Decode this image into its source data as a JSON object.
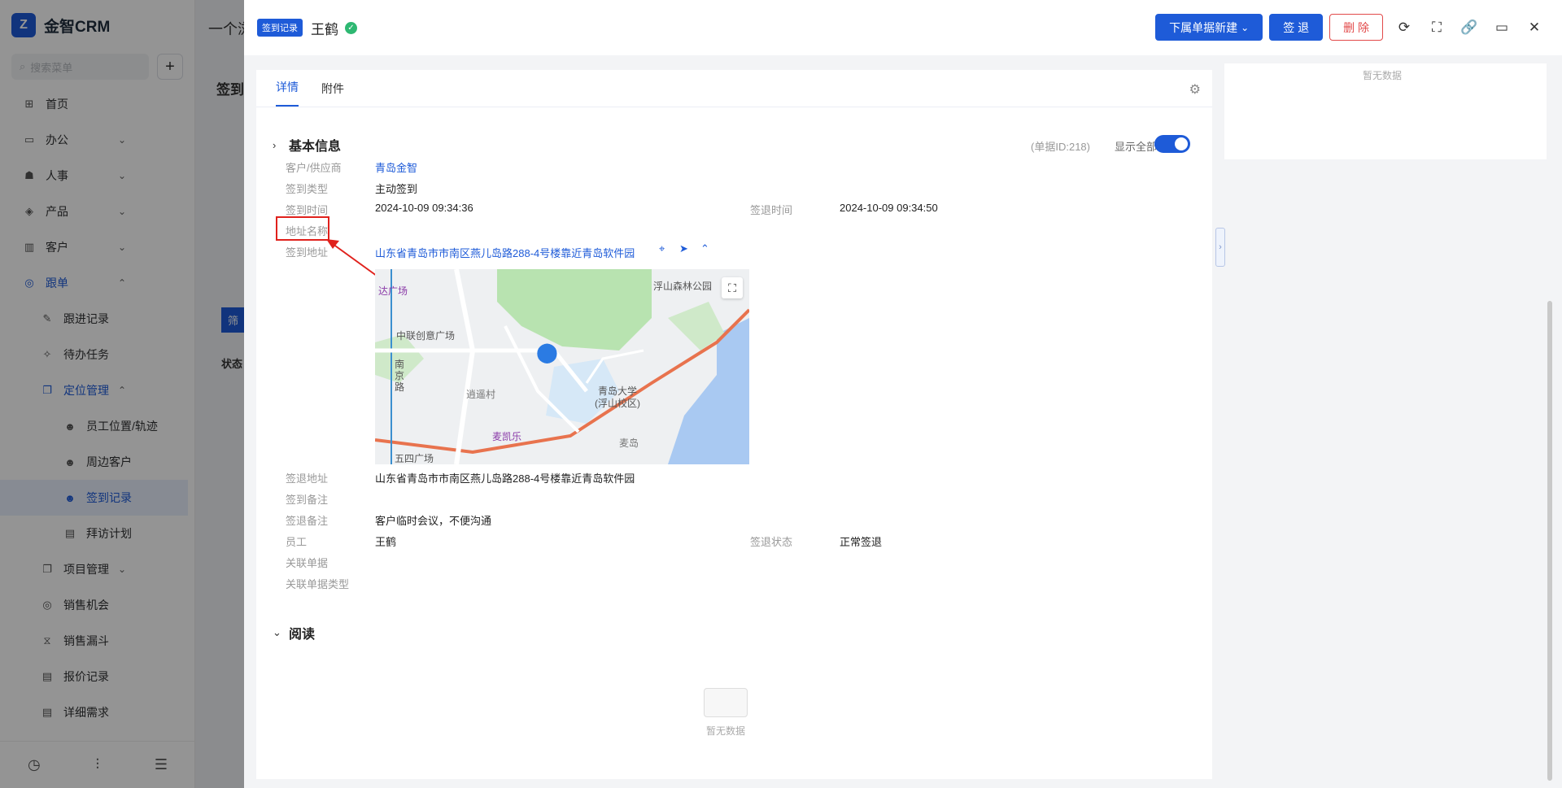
{
  "app": {
    "brand": "金智CRM",
    "breadcrumb": "一个浏",
    "search_placeholder": "搜索菜单",
    "add_icon": "plus-icon",
    "menu": [
      {
        "label": "首页",
        "icon": "home-icon",
        "level": 1
      },
      {
        "label": "办公",
        "icon": "office-icon",
        "level": 1,
        "chevron": "down"
      },
      {
        "label": "人事",
        "icon": "people-icon",
        "level": 1,
        "chevron": "down"
      },
      {
        "label": "产品",
        "icon": "product-icon",
        "level": 1,
        "chevron": "down"
      },
      {
        "label": "客户",
        "icon": "customer-icon",
        "level": 1,
        "chevron": "down"
      },
      {
        "label": "跟单",
        "icon": "track-icon",
        "level": 1,
        "chevron": "up",
        "active": true
      },
      {
        "label": "跟进记录",
        "icon": "note-icon",
        "level": 2
      },
      {
        "label": "待办任务",
        "icon": "pin-icon",
        "level": 2
      },
      {
        "label": "定位管理",
        "icon": "location-mgmt-icon",
        "level": 2,
        "chevron": "up",
        "active": true
      },
      {
        "label": "员工位置/轨迹",
        "icon": "staff-location-icon",
        "level": 3
      },
      {
        "label": "周边客户",
        "icon": "nearby-icon",
        "level": 3
      },
      {
        "label": "签到记录",
        "icon": "checkin-icon",
        "level": 3,
        "selected": true
      },
      {
        "label": "拜访计划",
        "icon": "plan-icon",
        "level": 3
      },
      {
        "label": "项目管理",
        "icon": "project-icon",
        "level": 2,
        "chevron": "down"
      },
      {
        "label": "销售机会",
        "icon": "opportunity-icon",
        "level": 2
      },
      {
        "label": "销售漏斗",
        "icon": "funnel-icon",
        "level": 2
      },
      {
        "label": "报价记录",
        "icon": "quote-icon",
        "level": 2
      },
      {
        "label": "详细需求",
        "icon": "requirement-icon",
        "level": 2
      }
    ],
    "main_title": "签到",
    "bg_filter_btn": "筛",
    "bg_status_header": "状态"
  },
  "drawer": {
    "tag": "签到记录",
    "name": "王鹤",
    "buttons": {
      "sub_new": "下属单据新建",
      "checkout": "签 退",
      "delete": "删 除"
    },
    "tabs": [
      "详情",
      "附件"
    ],
    "basic_info_title": "基本信息",
    "doc_id": "(单据ID:218)",
    "show_all": "显示全部",
    "show_all_on": true,
    "fields": {
      "customer_label": "客户/供应商",
      "customer_value": "青岛金智",
      "type_label": "签到类型",
      "type_value": "主动签到",
      "checkin_time_label": "签到时间",
      "checkin_time_value": "2024-10-09 09:34:36",
      "checkout_time_label": "签退时间",
      "checkout_time_value": "2024-10-09 09:34:50",
      "address_name_label": "地址名称",
      "checkin_addr_label": "签到地址",
      "checkin_addr_value": "山东省青岛市市南区燕儿岛路288-4号楼靠近青岛软件园",
      "checkout_addr_label": "签退地址",
      "checkout_addr_value": "山东省青岛市市南区燕儿岛路288-4号楼靠近青岛软件园",
      "checkin_note_label": "签到备注",
      "checkout_note_label": "签退备注",
      "checkout_note_value": "客户临时会议，不便沟通",
      "employee_label": "员工",
      "employee_value": "王鹤",
      "checkout_status_label": "签退状态",
      "checkout_status_value": "正常签退",
      "related_doc_label": "关联单据",
      "related_doc_type_label": "关联单据类型"
    },
    "map_labels": {
      "l1": "达广场",
      "l2": "浮山森林公园",
      "l3": "中联创意广场",
      "l4": "南京路",
      "l5": "逍遥村",
      "l6": "青岛大学",
      "l7": "(浮山校区)",
      "l8": "麦凯乐",
      "l9": "麦岛",
      "l10": "五四广场"
    },
    "read_title": "阅读",
    "empty_text": "暂无数据",
    "right_empty_text": "暂无数据"
  }
}
